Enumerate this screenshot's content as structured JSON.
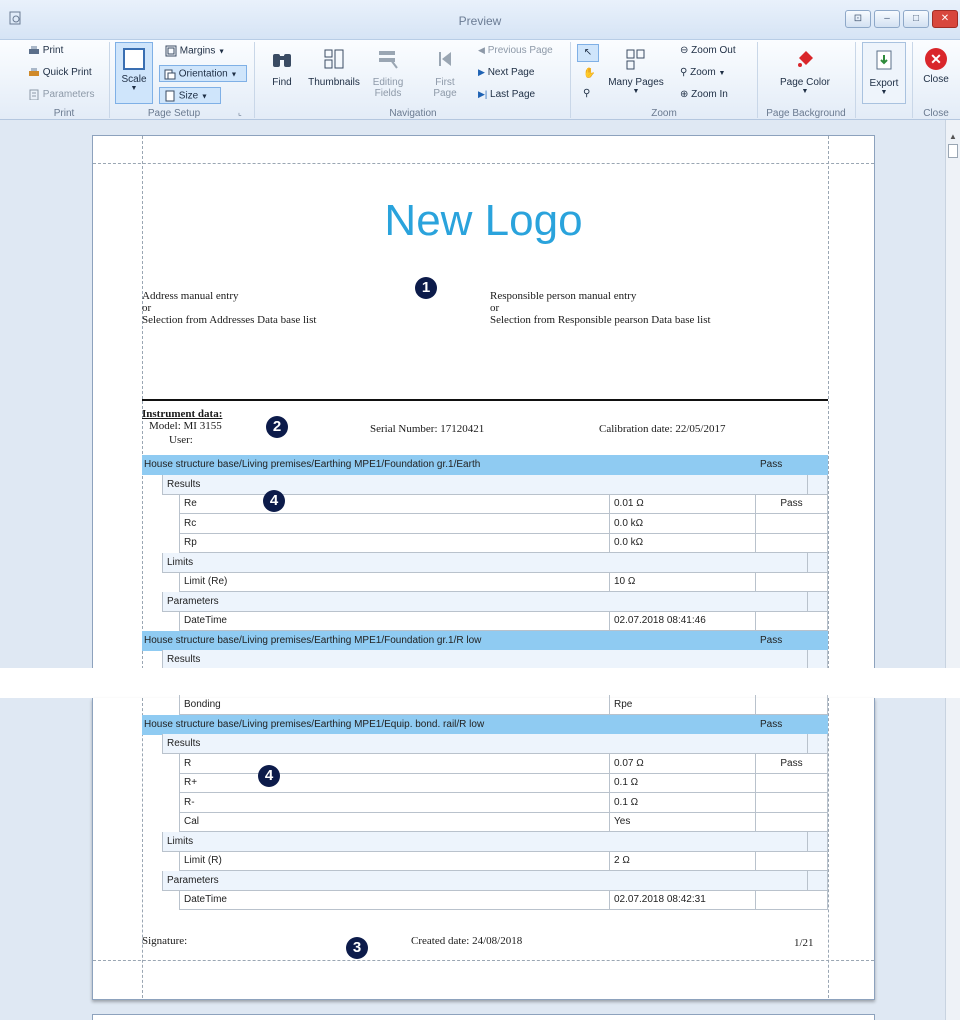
{
  "window": {
    "title": "Preview",
    "buttons": [
      "⊡",
      "–",
      "□",
      "✕"
    ]
  },
  "ribbon": {
    "print": {
      "items": [
        "Print",
        "Quick Print",
        "Parameters"
      ],
      "group": "Print"
    },
    "page_setup": {
      "scale": "Scale",
      "margins": "Margins",
      "orientation": "Orientation",
      "size": "Size",
      "group": "Page Setup"
    },
    "navigation": {
      "find": "Find",
      "thumbnails": "Thumbnails",
      "editing_fields": [
        "Editing",
        "Fields"
      ],
      "first_page": [
        "First",
        "Page"
      ],
      "previous_page": "Previous Page",
      "next_page": "Next Page",
      "last_page": "Last Page",
      "group": "Navigation"
    },
    "zoom": {
      "many_pages": "Many Pages",
      "zoom_out": "Zoom Out",
      "zoom": "Zoom",
      "zoom_in": "Zoom In",
      "group": "Zoom"
    },
    "page_background": {
      "page_color": "Page Color",
      "group": "Page Background"
    },
    "export": {
      "export": "Export"
    },
    "close": {
      "close": "Close",
      "group": "Close"
    }
  },
  "report": {
    "logo": "New Logo",
    "address": [
      "Address manual entry",
      "or",
      "Selection from Addresses Data base list"
    ],
    "responsible": [
      "Responsible person manual entry",
      "or",
      "Selection from Responsible pearson Data base list"
    ],
    "instrument_title": "Instrument data:",
    "model": "Model: MI 3155",
    "user": "User:",
    "serial": "Serial Number: 17120421",
    "calibration": "Calibration date: 22/05/2017",
    "markers": [
      "1",
      "2",
      "4",
      "4",
      "3"
    ],
    "page1_rows": [
      {
        "kind": "hdr",
        "name": "House structure base/Living premises/Earthing MPE1/Foundation gr.1/Earth",
        "value": "Pass",
        "status": ""
      },
      {
        "kind": "sub",
        "name": "Results",
        "value": "",
        "status": ""
      },
      {
        "kind": "item",
        "name": "Re",
        "value": "0.01 Ω",
        "status": "Pass"
      },
      {
        "kind": "item",
        "name": "Rc",
        "value": "0.0 kΩ",
        "status": ""
      },
      {
        "kind": "item",
        "name": "Rp",
        "value": "0.0 kΩ",
        "status": ""
      },
      {
        "kind": "sub",
        "name": "Limits",
        "value": "",
        "status": ""
      },
      {
        "kind": "item",
        "name": "Limit (Re)",
        "value": "10 Ω",
        "status": ""
      },
      {
        "kind": "sub",
        "name": "Parameters",
        "value": "",
        "status": ""
      },
      {
        "kind": "item",
        "name": "DateTime",
        "value": "02.07.2018 08:41:46",
        "status": ""
      },
      {
        "kind": "hdr",
        "name": "House structure base/Living premises/Earthing MPE1/Foundation gr.1/R low",
        "value": "Pass",
        "status": ""
      },
      {
        "kind": "sub",
        "name": "Results",
        "value": "",
        "status": ""
      }
    ],
    "page2_rows": [
      {
        "kind": "item",
        "name": "Bonding",
        "value": "Rpe",
        "status": ""
      },
      {
        "kind": "hdr",
        "name": "House structure base/Living premises/Earthing MPE1/Equip. bond. rail/R low",
        "value": "Pass",
        "status": ""
      },
      {
        "kind": "sub",
        "name": "Results",
        "value": "",
        "status": ""
      },
      {
        "kind": "item",
        "name": "R",
        "value": "0.07 Ω",
        "status": "Pass"
      },
      {
        "kind": "item",
        "name": "R+",
        "value": "0.1 Ω",
        "status": ""
      },
      {
        "kind": "item",
        "name": "R-",
        "value": "0.1 Ω",
        "status": ""
      },
      {
        "kind": "item",
        "name": "Cal",
        "value": "Yes",
        "status": ""
      },
      {
        "kind": "sub",
        "name": "Limits",
        "value": "",
        "status": ""
      },
      {
        "kind": "item",
        "name": "Limit (R)",
        "value": "2 Ω",
        "status": ""
      },
      {
        "kind": "sub",
        "name": "Parameters",
        "value": "",
        "status": ""
      },
      {
        "kind": "item",
        "name": "DateTime",
        "value": "02.07.2018 08:42:31",
        "status": ""
      }
    ],
    "signature": "Signature:",
    "created": "Created date: 24/08/2018",
    "page_number": "1/21"
  },
  "colors": {
    "header_row": "#8fcbf2",
    "subheader_row": "#edf4fc",
    "logo": "#2aa3dc",
    "marker": "#0c1b4a",
    "close_red": "#d9262b"
  }
}
